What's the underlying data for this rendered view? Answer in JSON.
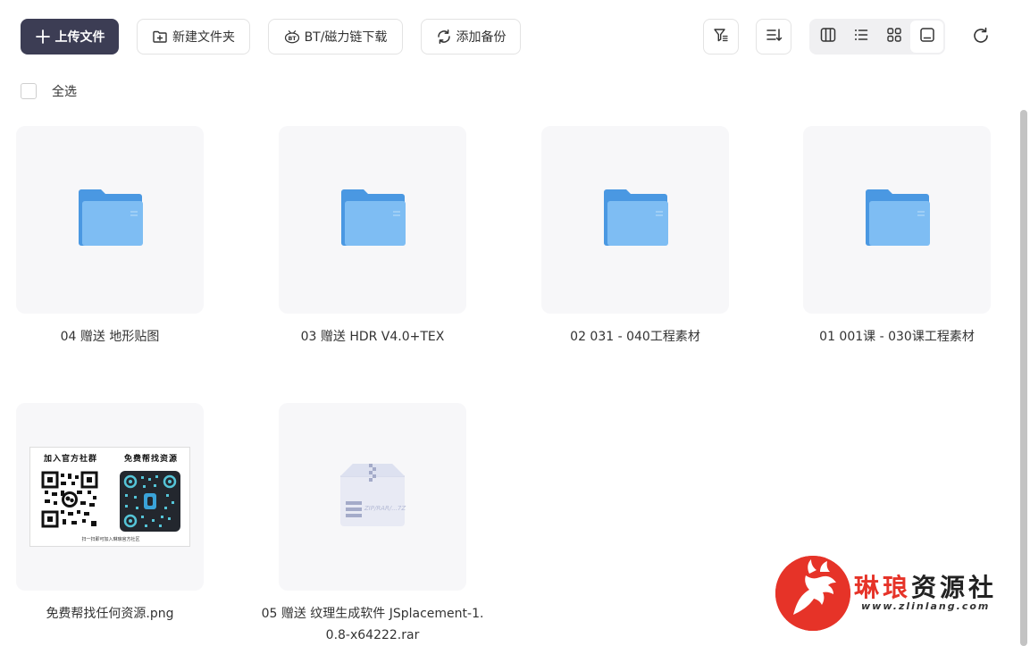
{
  "toolbar": {
    "upload_label": "上传文件",
    "new_folder_label": "新建文件夹",
    "bt_label": "BT/磁力链下载",
    "backup_label": "添加备份",
    "bt_icon_text": "BT"
  },
  "select_all": {
    "label": "全选"
  },
  "items": [
    {
      "name": "04 赠送 地形贴图",
      "kind": "folder"
    },
    {
      "name": "03 赠送 HDR V4.0+TEX",
      "kind": "folder"
    },
    {
      "name": "02 031 - 040工程素材",
      "kind": "folder"
    },
    {
      "name": "01 001课 - 030课工程素材",
      "kind": "folder"
    },
    {
      "name": "免费帮找任何资源.png",
      "kind": "image"
    },
    {
      "name": "05 赠送 纹理生成软件 JSplacement-1.0.8-x64222.rar",
      "kind": "archive"
    }
  ],
  "image_preview": {
    "left_title": "加入官方社群",
    "right_title": "免费帮找资源",
    "caption": "扫一扫即可加入琳琅官方社区"
  },
  "archive_icon_text": "ZIP/RAR/...7Z",
  "watermark": {
    "title_red": "琳琅",
    "title_dark": "资源社",
    "url": "www.zlinlang.com"
  },
  "colors": {
    "primary": "#3c3d54",
    "folder": "#6eb0ee",
    "watermark_red": "#e63328"
  }
}
